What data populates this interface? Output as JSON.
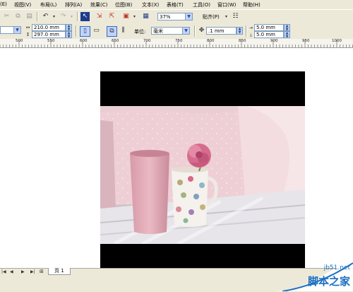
{
  "menubar": {
    "items": [
      "(E)",
      "视图(V)",
      "布局(L)",
      "排列(A)",
      "效果(C)",
      "位图(B)",
      "文本(X)",
      "表格(T)",
      "工具(O)",
      "窗口(W)",
      "帮助(H)"
    ]
  },
  "toolbar": {
    "zoom_value": "37%",
    "snap_label": "贴齐(P)",
    "page_width": "210.0 mm",
    "page_height": "297.0 mm",
    "units_label": "单位:",
    "units_value": "毫米",
    "nudge_value": ".1 mm",
    "dup_x": "5.0 mm",
    "dup_y": "5.0 mm"
  },
  "ruler": {
    "labels": [
      "500",
      "550",
      "600",
      "650",
      "700",
      "750",
      "800",
      "850",
      "900",
      "950",
      "1000"
    ]
  },
  "status": {
    "page_tab": "页 1"
  },
  "watermark": {
    "site": "jb51.net",
    "brand": "脚本之家"
  },
  "colors": {
    "chrome": "#ece9d8",
    "field_border": "#7f9db9",
    "canvas": "#ffffff",
    "frame": "#000000",
    "watermark_blue": "#1b6fc1"
  }
}
